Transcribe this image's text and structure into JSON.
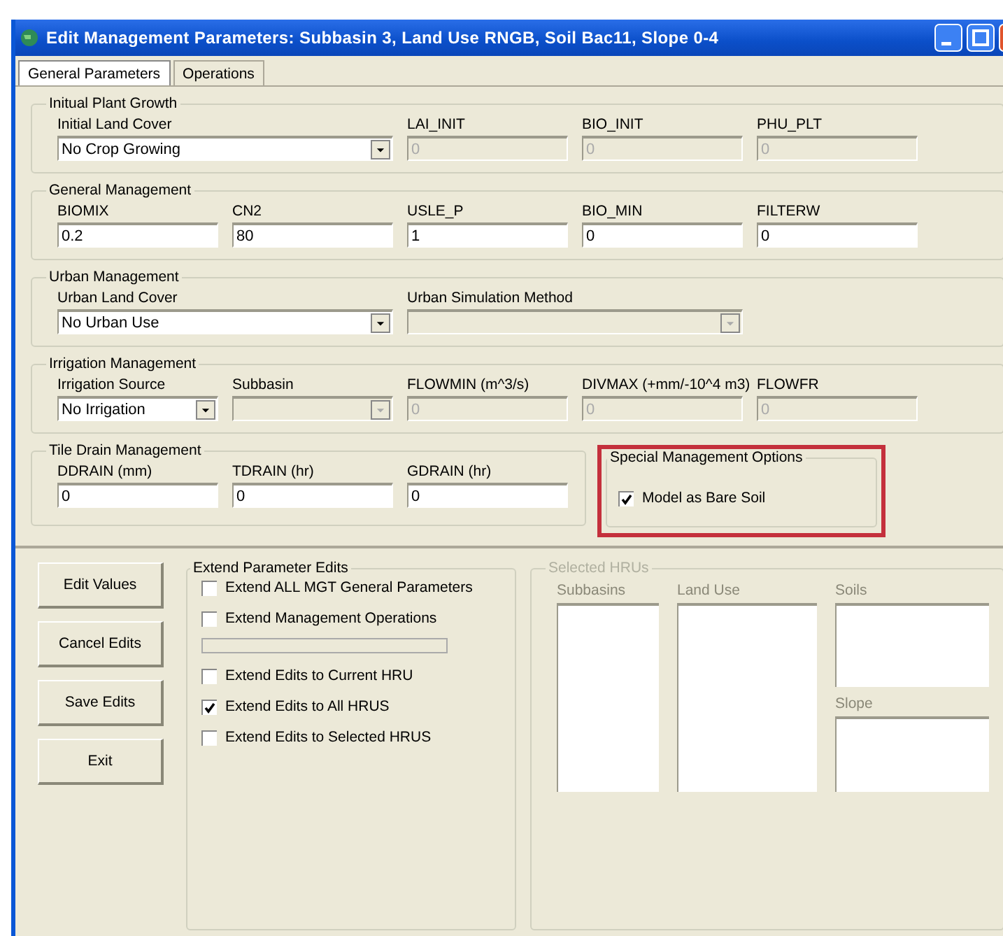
{
  "window": {
    "title": "Edit Management Parameters: Subbasin 3, Land Use RNGB, Soil Bac11, Slope 0-4"
  },
  "tabs": [
    {
      "label": "General Parameters",
      "selected": true
    },
    {
      "label": "Operations",
      "selected": false
    }
  ],
  "groups": [
    {
      "title": "Initual Plant Growth",
      "fields": [
        {
          "kind": "dropdown",
          "label": "Initial Land Cover",
          "value": "No Crop Growing",
          "disabled": false
        },
        {
          "kind": "text",
          "label": "LAI_INIT",
          "value": "0",
          "disabled": true
        },
        {
          "kind": "text",
          "label": "BIO_INIT",
          "value": "0",
          "disabled": true
        },
        {
          "kind": "text",
          "label": "PHU_PLT",
          "value": "0",
          "disabled": true
        }
      ]
    },
    {
      "title": "General Management",
      "fields": [
        {
          "kind": "text",
          "label": "BIOMIX",
          "value": "0.2",
          "disabled": false
        },
        {
          "kind": "text",
          "label": "CN2",
          "value": "80",
          "disabled": false
        },
        {
          "kind": "text",
          "label": "USLE_P",
          "value": "1",
          "disabled": false
        },
        {
          "kind": "text",
          "label": "BIO_MIN",
          "value": "0",
          "disabled": false
        },
        {
          "kind": "text",
          "label": "FILTERW",
          "value": "0",
          "disabled": false
        }
      ]
    },
    {
      "title": "Urban Management",
      "fields": [
        {
          "kind": "dropdown",
          "label": "Urban Land Cover",
          "value": "No Urban Use",
          "disabled": false
        },
        {
          "kind": "dropdown",
          "label": "Urban Simulation Method",
          "disabled": true
        }
      ]
    },
    {
      "title": "Irrigation Management",
      "fields": [
        {
          "kind": "dropdown",
          "label": "Irrigation Source",
          "value": "No Irrigation",
          "disabled": false
        },
        {
          "kind": "dropdown",
          "label": "Subbasin",
          "disabled": true
        },
        {
          "kind": "text",
          "label": "FLOWMIN (m^3/s)",
          "value": "0",
          "disabled": true
        },
        {
          "kind": "text",
          "label": "DIVMAX (+mm/-10^4 m3)",
          "value": "0",
          "disabled": true
        },
        {
          "kind": "text",
          "label": "FLOWFR",
          "value": "0",
          "disabled": true
        }
      ]
    },
    {
      "title": "Tile Drain Management",
      "fields": [
        {
          "kind": "text",
          "label": "DDRAIN (mm)",
          "value": "0",
          "disabled": false
        },
        {
          "kind": "text",
          "label": "TDRAIN (hr)",
          "value": "0",
          "disabled": false
        },
        {
          "kind": "text",
          "label": "GDRAIN (hr)",
          "value": "0",
          "disabled": false
        }
      ]
    }
  ],
  "special_options": {
    "title": "Special Management Options",
    "highlighted": true,
    "options": [
      {
        "label": "Model as Bare Soil",
        "checked": true
      }
    ]
  },
  "buttons": [
    "Edit Values",
    "Cancel Edits",
    "Save Edits",
    "Exit"
  ],
  "extend": {
    "title": "Extend Parameter Edits",
    "options": [
      {
        "label": "Extend ALL MGT General Parameters",
        "checked": false
      },
      {
        "label": "Extend Management Operations",
        "checked": false
      }
    ],
    "progress": {
      "level": 0
    },
    "targets": [
      {
        "label": "Extend Edits to Current HRU",
        "checked": false
      },
      {
        "label": "Extend Edits to All HRUS",
        "checked": true
      },
      {
        "label": "Extend Edits to Selected HRUS",
        "checked": false
      }
    ]
  },
  "selected_hrus": {
    "title": "Selected HRUs",
    "lists": [
      "Subbasins",
      "Land Use",
      "Soils",
      "Slope"
    ]
  }
}
